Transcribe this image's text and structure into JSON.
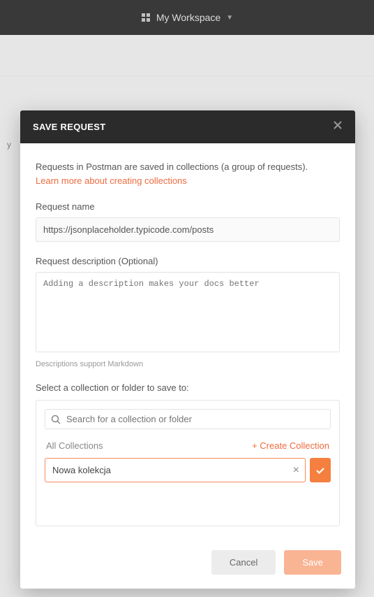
{
  "topbar": {
    "workspace_label": "My Workspace"
  },
  "sidebar": {
    "history_label": "y"
  },
  "modal": {
    "title": "SAVE REQUEST",
    "intro_text": "Requests in Postman are saved in collections (a group of requests).",
    "learn_more": "Learn more about creating collections",
    "request_name_label": "Request name",
    "request_name_value": "https://jsonplaceholder.typicode.com/posts",
    "description_label": "Request description (Optional)",
    "description_placeholder": "Adding a description makes your docs better",
    "markdown_hint": "Descriptions support Markdown",
    "select_label": "Select a collection or folder to save to:",
    "search_placeholder": "Search for a collection or folder",
    "all_collections": "All Collections",
    "create_collection": "+ Create Collection",
    "new_collection_value": "Nowa kolekcja",
    "cancel_label": "Cancel",
    "save_label": "Save"
  }
}
